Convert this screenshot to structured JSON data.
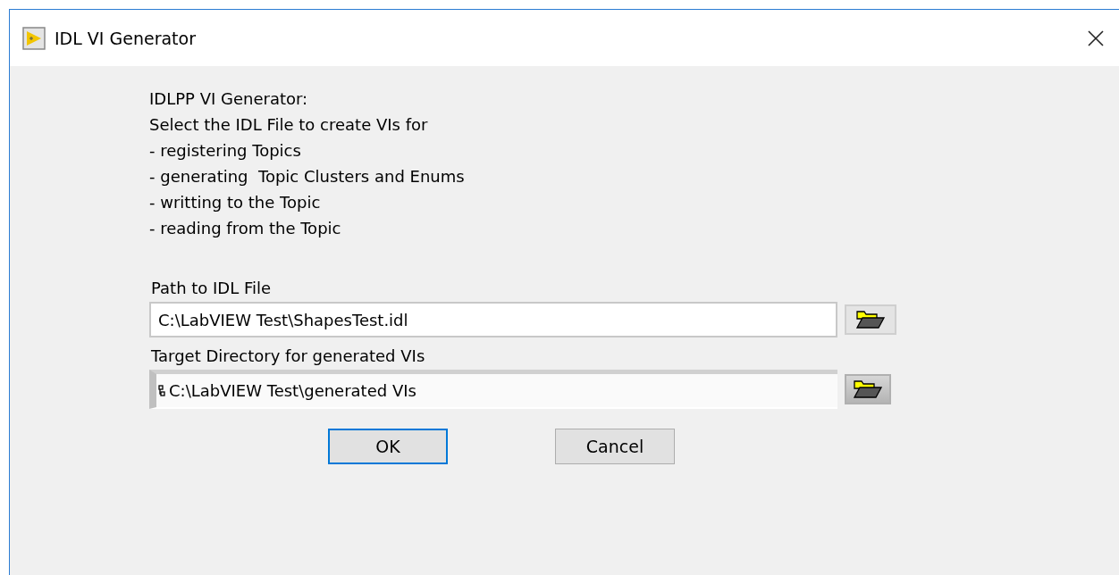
{
  "window": {
    "title": "IDL VI Generator"
  },
  "description": [
    "IDLPP VI Generator:",
    "Select the IDL File to create VIs for",
    "- registering Topics",
    "- generating  Topic Clusters and Enums",
    "- writting to the Topic",
    "- reading from the Topic"
  ],
  "fields": [
    {
      "kind": "input",
      "label": "Path to IDL File",
      "value": "C:\\LabVIEW Test\\ShapesTest.idl"
    },
    {
      "kind": "indicator",
      "label": "Target Directory for generated VIs",
      "value": "C:\\LabVIEW Test\\generated VIs"
    }
  ],
  "buttons": [
    {
      "label": "OK",
      "selected": true
    },
    {
      "label": "Cancel",
      "selected": false
    }
  ]
}
